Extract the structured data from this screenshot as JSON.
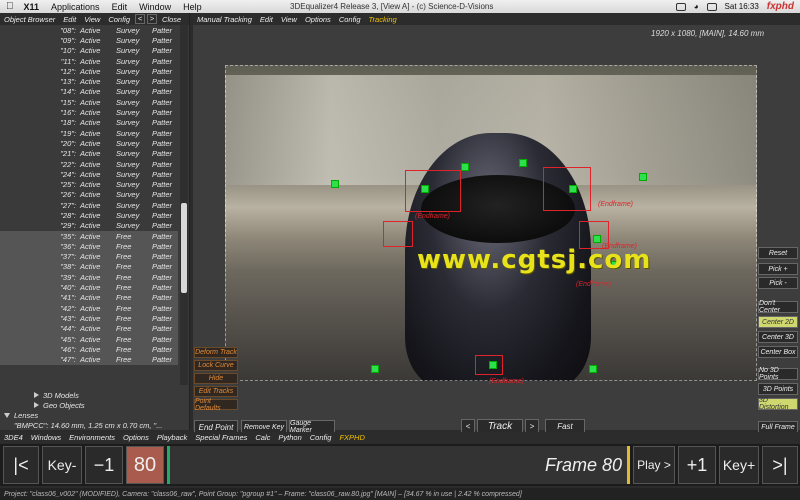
{
  "menubar": {
    "items": [
      "X11",
      "Applications",
      "Edit",
      "Window",
      "Help"
    ],
    "window_title": "3DEqualizer4 Release 3, [View A]  -  (c) Science-D-Visions",
    "clock": "Sat 16:33",
    "brand": "fxphd"
  },
  "left_panel": {
    "menu": [
      "Object Browser",
      "Edit",
      "View",
      "Config"
    ],
    "close_label": "Close",
    "rows": [
      {
        "name": "\"08\":",
        "status": "Active",
        "mode": "Survey",
        "kind": "Patter"
      },
      {
        "name": "\"09\":",
        "status": "Active",
        "mode": "Survey",
        "kind": "Patter"
      },
      {
        "name": "\"10\":",
        "status": "Active",
        "mode": "Survey",
        "kind": "Patter"
      },
      {
        "name": "\"11\":",
        "status": "Active",
        "mode": "Survey",
        "kind": "Patter"
      },
      {
        "name": "\"12\":",
        "status": "Active",
        "mode": "Survey",
        "kind": "Patter"
      },
      {
        "name": "\"13\":",
        "status": "Active",
        "mode": "Survey",
        "kind": "Patter"
      },
      {
        "name": "\"14\":",
        "status": "Active",
        "mode": "Survey",
        "kind": "Patter"
      },
      {
        "name": "\"15\":",
        "status": "Active",
        "mode": "Survey",
        "kind": "Patter"
      },
      {
        "name": "\"16\":",
        "status": "Active",
        "mode": "Survey",
        "kind": "Patter"
      },
      {
        "name": "\"18\":",
        "status": "Active",
        "mode": "Survey",
        "kind": "Patter"
      },
      {
        "name": "\"19\":",
        "status": "Active",
        "mode": "Survey",
        "kind": "Patter"
      },
      {
        "name": "\"20\":",
        "status": "Active",
        "mode": "Survey",
        "kind": "Patter"
      },
      {
        "name": "\"21\":",
        "status": "Active",
        "mode": "Survey",
        "kind": "Patter"
      },
      {
        "name": "\"22\":",
        "status": "Active",
        "mode": "Survey",
        "kind": "Patter"
      },
      {
        "name": "\"24\":",
        "status": "Active",
        "mode": "Survey",
        "kind": "Patter"
      },
      {
        "name": "\"25\":",
        "status": "Active",
        "mode": "Survey",
        "kind": "Patter"
      },
      {
        "name": "\"26\":",
        "status": "Active",
        "mode": "Survey",
        "kind": "Patter"
      },
      {
        "name": "\"27\":",
        "status": "Active",
        "mode": "Survey",
        "kind": "Patter"
      },
      {
        "name": "\"28\":",
        "status": "Active",
        "mode": "Survey",
        "kind": "Patter"
      },
      {
        "name": "\"29\":",
        "status": "Active",
        "mode": "Survey",
        "kind": "Patter"
      },
      {
        "name": "\"35\":",
        "status": "Active",
        "mode": "Free",
        "kind": "Patter"
      },
      {
        "name": "\"36\":",
        "status": "Active",
        "mode": "Free",
        "kind": "Patter"
      },
      {
        "name": "\"37\":",
        "status": "Active",
        "mode": "Free",
        "kind": "Patter"
      },
      {
        "name": "\"38\":",
        "status": "Active",
        "mode": "Free",
        "kind": "Patter"
      },
      {
        "name": "\"39\":",
        "status": "Active",
        "mode": "Free",
        "kind": "Patter"
      },
      {
        "name": "\"40\":",
        "status": "Active",
        "mode": "Free",
        "kind": "Patter"
      },
      {
        "name": "\"41\":",
        "status": "Active",
        "mode": "Free",
        "kind": "Patter"
      },
      {
        "name": "\"42\":",
        "status": "Active",
        "mode": "Free",
        "kind": "Patter"
      },
      {
        "name": "\"43\":",
        "status": "Active",
        "mode": "Free",
        "kind": "Patter"
      },
      {
        "name": "\"44\":",
        "status": "Active",
        "mode": "Free",
        "kind": "Patter"
      },
      {
        "name": "\"45\":",
        "status": "Active",
        "mode": "Free",
        "kind": "Patter"
      },
      {
        "name": "\"46\":",
        "status": "Active",
        "mode": "Free",
        "kind": "Patter"
      },
      {
        "name": "\"47\":",
        "status": "Active",
        "mode": "Free",
        "kind": "Patter"
      }
    ],
    "models_label": "3D Models",
    "geo_label": "Geo Objects",
    "lenses_label": "Lenses",
    "lens_entry": "\"BMPCC\": 14.60 mm, 1.25 cm x 0.70 cm, \"..."
  },
  "main": {
    "menu": [
      "Manual Tracking",
      "Edit",
      "View",
      "Options",
      "Config",
      "Tracking"
    ],
    "resolution_info": "1920 x 1080, [MAIN], 14.60 mm",
    "watermark": "www.cgtsj.com",
    "endframe_label": "(Endframe)",
    "right_buttons": [
      "Reset",
      "Pick +",
      "Pick -",
      "Don't Center",
      "Center 2D",
      "Center 3D",
      "Center Box",
      "No 3D Points",
      "3D Points",
      "3D Distortion",
      "Full Frame"
    ],
    "left_buttons": [
      "Deform Track",
      "Lock Curve",
      "Hide",
      "Edit Tracks",
      "Point Defaults"
    ],
    "bottom_buttons": {
      "end_point": "End Point",
      "remove_key": "Remove Key",
      "gauge_marker": "Gauge Marker",
      "prev": "<",
      "track": "Track",
      "next": ">",
      "fast": "Fast"
    }
  },
  "bottom_menu": [
    "3DE4",
    "Windows",
    "Environments",
    "Options",
    "Playback",
    "Special Frames",
    "Calc",
    "Python",
    "Config",
    "FXPHD"
  ],
  "timeline": {
    "first": "|<",
    "key_minus": "Key-",
    "minus_one": "−1",
    "frame_value": "80",
    "frame_label": "Frame 80",
    "play": "Play >",
    "plus_one": "+1",
    "key_plus": "Key+",
    "last": ">|"
  },
  "status": "Project: \"class06_v002\" (MODIFIED), Camera: \"class06_raw\", Point Group: \"pgroup #1\"  –  Frame: \"class06_raw.80.jpg\" [MAIN]  –  [34.67 % in use | 2.42 % compressed]"
}
